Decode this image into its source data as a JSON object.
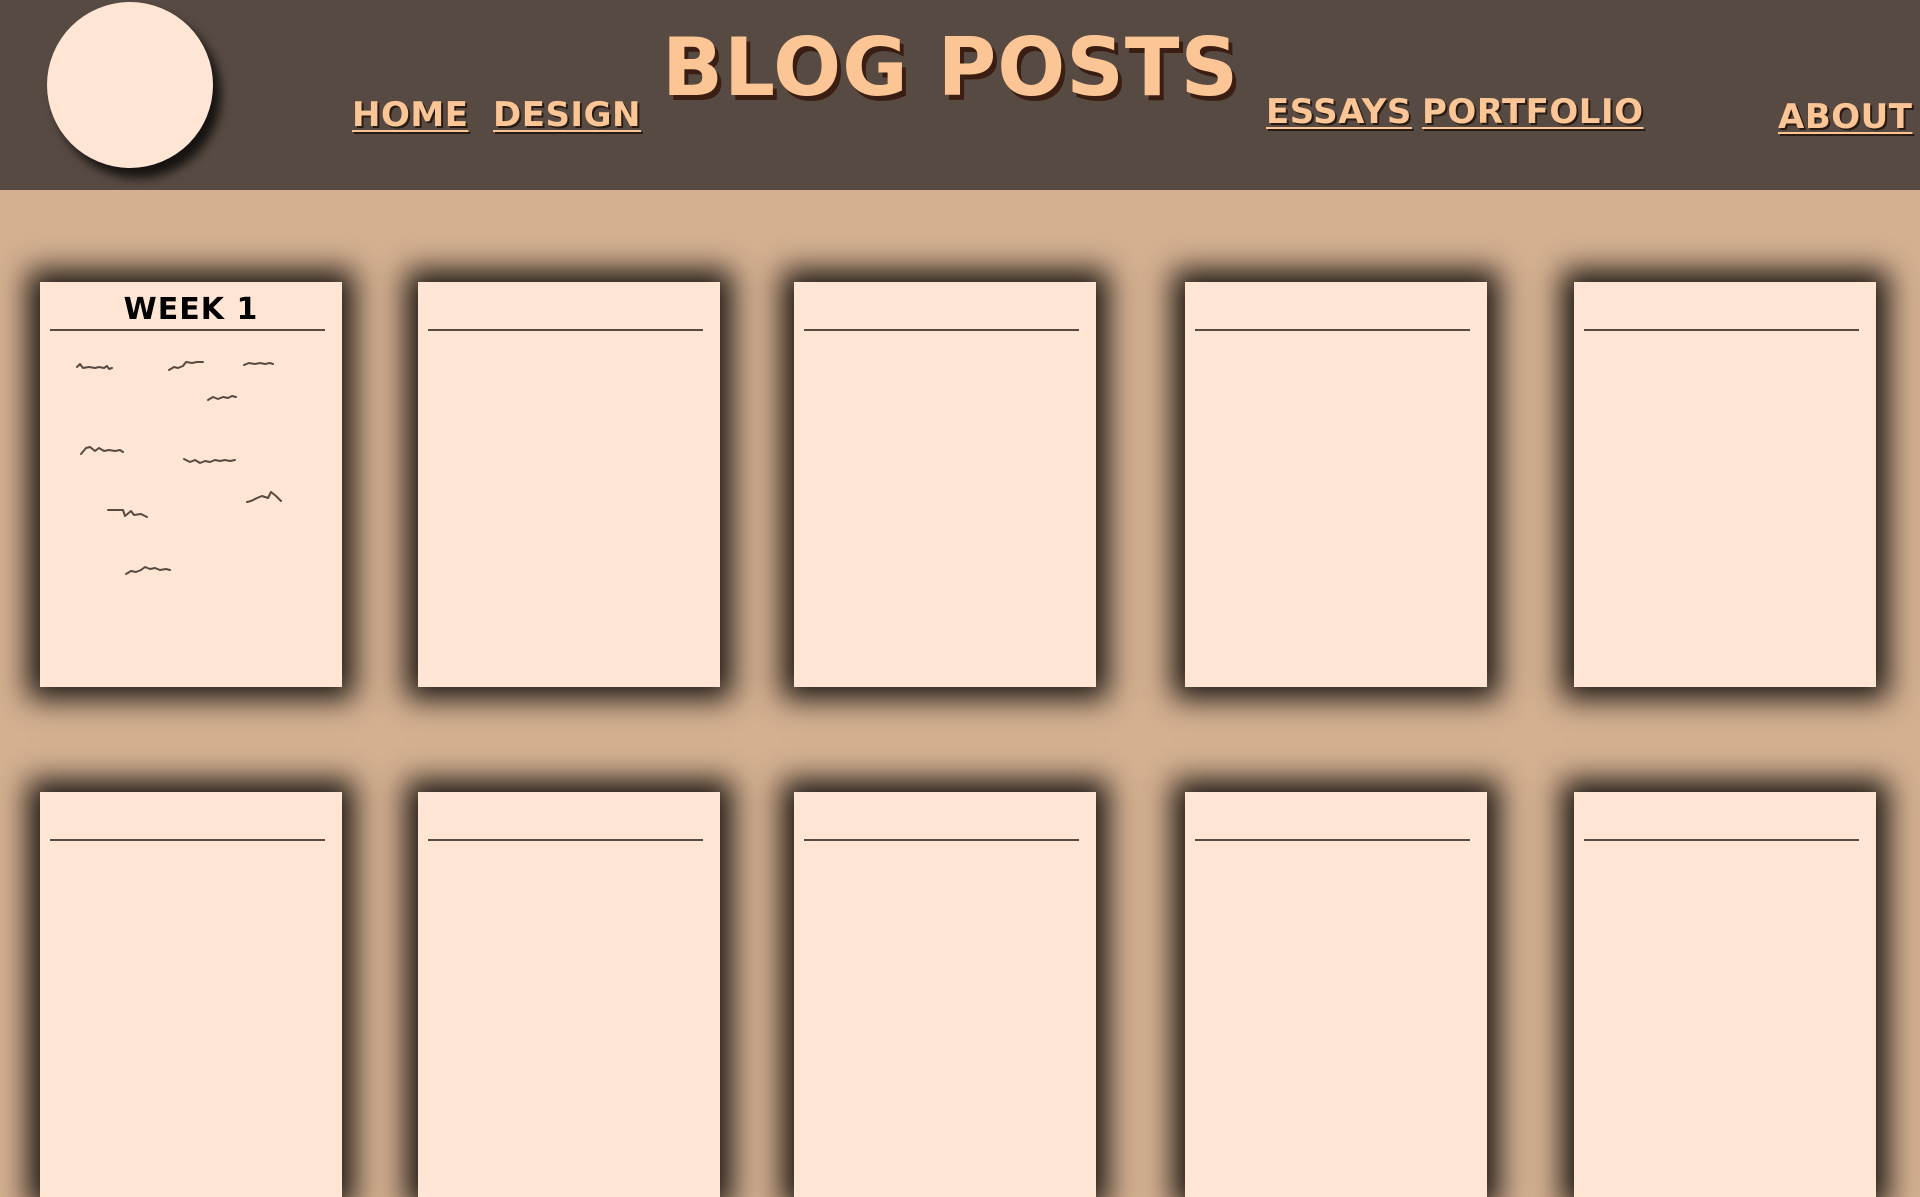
{
  "header": {
    "title": "BLOG POSTS",
    "nav": {
      "home": "HOME",
      "design": "DESIGN",
      "essays": "ESSAYS",
      "portfolio": "PORTFOLIO",
      "about": "ABOUT"
    }
  },
  "posts": [
    {
      "title": "WEEK 1"
    },
    {
      "title": ""
    },
    {
      "title": ""
    },
    {
      "title": ""
    },
    {
      "title": ""
    },
    {
      "title": ""
    },
    {
      "title": ""
    },
    {
      "title": ""
    },
    {
      "title": ""
    },
    {
      "title": ""
    }
  ],
  "colors": {
    "header_bg": "#574a42",
    "page_bg": "#d4b091",
    "card_bg": "#ffe6d4",
    "accent_text": "#fcc596"
  }
}
